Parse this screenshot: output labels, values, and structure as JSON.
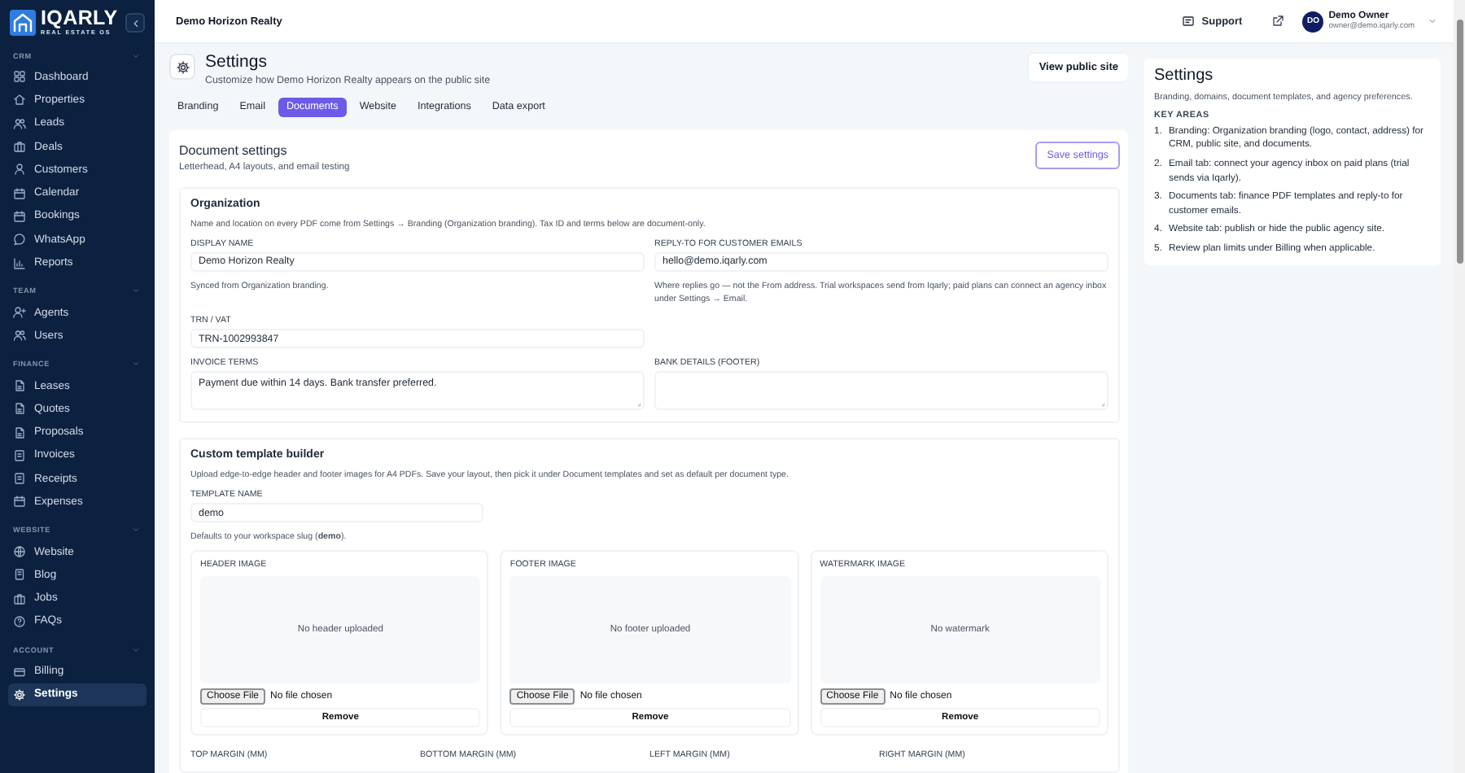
{
  "brand": {
    "name": "IQARLY",
    "tagline": "REAL ESTATE OS"
  },
  "sidebar": {
    "sections": [
      {
        "title": "CRM",
        "expanded": true,
        "items": [
          {
            "label": "Dashboard",
            "selected": false
          },
          {
            "label": "Properties",
            "selected": false
          },
          {
            "label": "Leads",
            "selected": false
          },
          {
            "label": "Deals",
            "selected": false
          },
          {
            "label": "Customers",
            "selected": false
          },
          {
            "label": "Calendar",
            "selected": false
          },
          {
            "label": "Bookings",
            "selected": false
          },
          {
            "label": "WhatsApp",
            "selected": false
          },
          {
            "label": "Reports",
            "selected": false
          }
        ]
      },
      {
        "title": "TEAM",
        "expanded": true,
        "items": [
          {
            "label": "Agents",
            "selected": false
          },
          {
            "label": "Users",
            "selected": false
          }
        ]
      },
      {
        "title": "FINANCE",
        "expanded": true,
        "items": [
          {
            "label": "Leases",
            "selected": false
          },
          {
            "label": "Quotes",
            "selected": false
          },
          {
            "label": "Proposals",
            "selected": false
          },
          {
            "label": "Invoices",
            "selected": false
          },
          {
            "label": "Receipts",
            "selected": false
          },
          {
            "label": "Expenses",
            "selected": false
          }
        ]
      },
      {
        "title": "WEBSITE",
        "expanded": true,
        "items": [
          {
            "label": "Website",
            "selected": false
          },
          {
            "label": "Blog",
            "selected": false
          },
          {
            "label": "Jobs",
            "selected": false
          },
          {
            "label": "FAQs",
            "selected": false
          }
        ]
      },
      {
        "title": "ACCOUNT",
        "expanded": true,
        "items": [
          {
            "label": "Billing",
            "selected": false
          },
          {
            "label": "Settings",
            "selected": true
          }
        ]
      }
    ]
  },
  "topbar": {
    "workspace": "Demo Horizon Realty",
    "support": "Support",
    "user": {
      "initials": "DO",
      "name": "Demo Owner",
      "email": "owner@demo.iqarly.com"
    }
  },
  "page": {
    "title": "Settings",
    "subtitle": "Customize how Demo Horizon Realty appears on the public site",
    "action": "View public site",
    "tabs": [
      {
        "label": "Branding",
        "selected": false
      },
      {
        "label": "Email",
        "selected": false
      },
      {
        "label": "Documents",
        "selected": true
      },
      {
        "label": "Website",
        "selected": false
      },
      {
        "label": "Integrations",
        "selected": false
      },
      {
        "label": "Data export",
        "selected": false
      }
    ]
  },
  "document_settings": {
    "title": "Document settings",
    "subtitle": "Letterhead, A4 layouts, and email testing",
    "save": "Save settings"
  },
  "organization": {
    "title": "Organization",
    "description": "Name and location on every PDF come from Settings → Branding (Organization branding). Tax ID and terms below are document-only.",
    "display_name": {
      "label": "DISPLAY NAME",
      "value": "Demo Horizon Realty",
      "hint": "Synced from Organization branding."
    },
    "reply_to": {
      "label": "REPLY-TO FOR CUSTOMER EMAILS",
      "value": "hello@demo.iqarly.com",
      "hint": "Where replies go — not the From address. Trial workspaces send from Iqarly; paid plans can connect an agency inbox under Settings → Email."
    },
    "trn": {
      "label": "TRN / VAT",
      "value": "TRN-1002993847"
    },
    "invoice_terms": {
      "label": "INVOICE TERMS",
      "value": "Payment due within 14 days. Bank transfer preferred."
    },
    "bank_details": {
      "label": "BANK DETAILS (FOOTER)"
    }
  },
  "template_builder": {
    "title": "Custom template builder",
    "description": "Upload edge-to-edge header and footer images for A4 PDFs. Save your layout, then pick it under Document templates and set as default per document type.",
    "template_name": {
      "label": "TEMPLATE NAME",
      "value": "demo",
      "hint": "Defaults to your workspace slug (**demo**)."
    },
    "uploads": [
      {
        "label": "HEADER IMAGE",
        "empty": "No header uploaded",
        "button": "Choose File",
        "status": "No file chosen",
        "remove": "Remove"
      },
      {
        "label": "FOOTER IMAGE",
        "empty": "No footer uploaded",
        "button": "Choose File",
        "status": "No file chosen",
        "remove": "Remove"
      },
      {
        "label": "WATERMARK IMAGE",
        "empty": "No watermark",
        "button": "Choose File",
        "status": "No file chosen",
        "remove": "Remove"
      }
    ],
    "margins": [
      "TOP MARGIN (MM)",
      "BOTTOM MARGIN (MM)",
      "LEFT MARGIN (MM)",
      "RIGHT MARGIN (MM)"
    ]
  },
  "help": {
    "title": "Settings",
    "description": "Branding, domains, document templates, and agency preferences.",
    "heading": "KEY AREAS",
    "items": [
      {
        "number": "1.",
        "text": "Branding: Organization branding (logo, contact, address) for CRM, public site, and documents."
      },
      {
        "number": "2.",
        "text": "Email tab: connect your agency inbox on paid plans (trial sends via Iqarly)."
      },
      {
        "number": "3.",
        "text": "Documents tab: finance PDF templates and reply-to for customer emails."
      },
      {
        "number": "4.",
        "text": "Website tab: publish or hide the public agency site."
      },
      {
        "number": "5.",
        "text": "Review plan limits under Billing when applicable."
      }
    ]
  }
}
